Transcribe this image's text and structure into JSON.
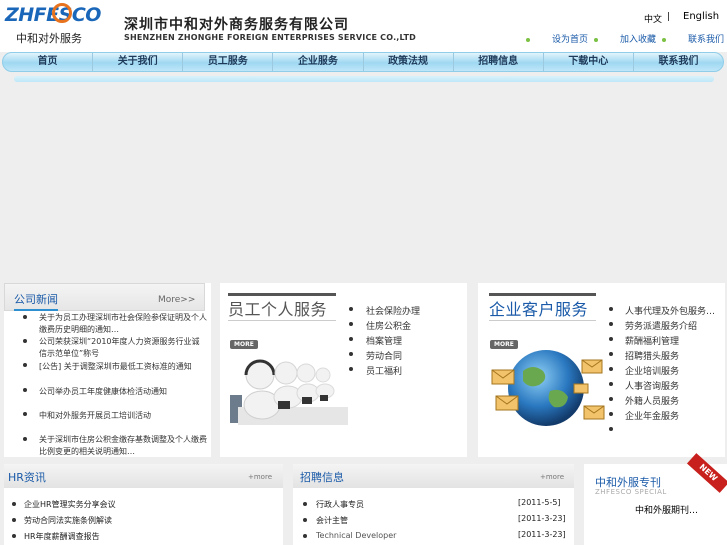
{
  "header": {
    "logo_text": "ZHFESCO",
    "logo_sub": "中和对外服务",
    "company_cn": "深圳市中和对外商务服务有限公司",
    "company_en": "SHENZHEN ZHONGHE FOREIGN ENTERPRISES SERVICE CO.,LTD",
    "lang_cn": "中文",
    "lang_sep": "|",
    "lang_en": "English",
    "top_links": [
      "设为首页",
      "加入收藏",
      "联系我们"
    ]
  },
  "nav": {
    "items": [
      "首页",
      "关于我们",
      "员工服务",
      "企业服务",
      "政策法规",
      "招聘信息",
      "下载中心",
      "联系我们"
    ]
  },
  "news": {
    "title": "公司新闻",
    "more": "More>>",
    "items": [
      "关于为员工办理深圳市社会保险参保证明及个人缴费历史明细的通知…",
      "公司荣获深圳“2010年度人力资源服务行业诚信示范单位”称号",
      "[公告] 关于调整深圳市最低工资标准的通知",
      "公司举办员工年度健康体检活动通知",
      "中和对外服务开展员工培训活动",
      "关于深圳市住房公积金缴存基数调整及个人缴费比例变更的相关说明通知…"
    ]
  },
  "employee_service": {
    "title": "员工个人服务",
    "more": "MORE",
    "items": [
      "社会保险办理",
      "住房公积金",
      "档案管理",
      "劳动合同",
      "员工福利"
    ]
  },
  "enterprise_service": {
    "title": "企业客户服务",
    "more": "MORE",
    "items": [
      "人事代理及外包服务…",
      "劳务派遣服务介绍",
      "薪酬福利管理",
      "招聘猎头服务",
      "企业培训服务",
      "人事咨询服务",
      "外籍人员服务",
      "企业年金服务"
    ]
  },
  "hr_news": {
    "title": "HR资讯",
    "more": "+more",
    "items": [
      "企业HR管理实务分享会议",
      "劳动合同法实施条例解读",
      "HR年度薪酬调查报告"
    ]
  },
  "jobs": {
    "title": "招聘信息",
    "more": "+more",
    "rows": [
      {
        "title": "行政人事专员",
        "date": "[2011-5-5]"
      },
      {
        "title": "会计主管",
        "date": "[2011-3-23]"
      },
      {
        "title": "Technical Developer",
        "date": "[2011-3-23]"
      }
    ]
  },
  "special": {
    "title": "中和外服专刊",
    "subtitle": "ZHFESCO SPECIAL",
    "item": "中和外服期刊…",
    "badge": "NEW"
  },
  "colors": {
    "accent_blue": "#1a5aa8",
    "nav_bg": "#9fd8f2",
    "logo_orange": "#e8731e",
    "bullet_green": "#7ac143",
    "ribbon_red": "#c8201c"
  }
}
